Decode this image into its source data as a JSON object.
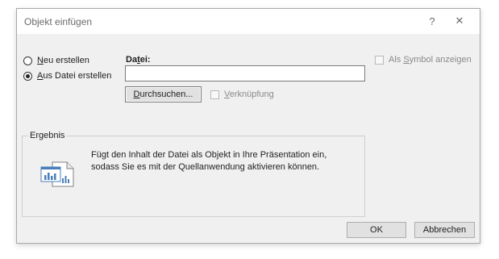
{
  "window": {
    "title": "Objekt einfügen",
    "help_glyph": "?",
    "close_glyph": "✕"
  },
  "options": {
    "new": {
      "prefix": "",
      "mnemonic": "N",
      "suffix": "eu erstellen",
      "checked": false
    },
    "from_file": {
      "prefix": "",
      "mnemonic": "A",
      "suffix": "us Datei erstellen",
      "checked": true
    }
  },
  "file": {
    "label_prefix": "Da",
    "label_mnemonic": "t",
    "label_suffix": "ei:",
    "value": "",
    "browse_prefix": "",
    "browse_mnemonic": "D",
    "browse_suffix": "urchsuchen..."
  },
  "link": {
    "prefix": "",
    "mnemonic": "V",
    "suffix": "erknüpfung",
    "checked": false
  },
  "symbol": {
    "prefix": "Als ",
    "mnemonic": "S",
    "suffix": "ymbol anzeigen",
    "checked": false
  },
  "result": {
    "title": "Ergebnis",
    "line1": "Fügt den Inhalt der Datei als Objekt in Ihre Präsentation ein,",
    "line2": "sodass Sie es mit der Quellanwendung aktivieren können.",
    "icon": "embedded-document-icon"
  },
  "buttons": {
    "ok": "OK",
    "cancel": "Abbrechen"
  },
  "colors": {
    "dialog_bg": "#f0f0f0",
    "titlebar_bg": "#ffffff",
    "icon_blue": "#4a7ebb"
  }
}
